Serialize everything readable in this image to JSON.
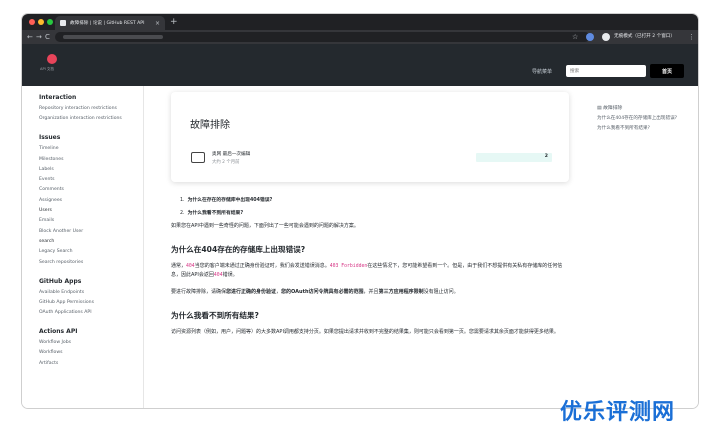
{
  "browser": {
    "tab_title": "故障排除 | 论说 | GitHub REST API",
    "tab_close": "×",
    "new_tab": "+",
    "back": "←",
    "forward": "→",
    "reload": "C",
    "star": "☆",
    "incognito_label": "无痕模式（已打开 2 个窗口）",
    "menu": "⋮"
  },
  "header": {
    "logo_sub": "API 文档",
    "nav_menu": "导航菜单",
    "search_placeholder": "搜索",
    "home_button": "首页"
  },
  "sidebar": {
    "groups": [
      {
        "title": "Interaction",
        "items": [
          "Repository interaction restrictions",
          "Organization interaction restrictions"
        ]
      },
      {
        "title": "Issues",
        "items": [
          "Timeline",
          "Milestones",
          "Labels",
          "Events",
          "Comments",
          "Assignees",
          "Users",
          "Emails",
          "Block Another User",
          "search",
          "Legacy Search",
          "Search repositories"
        ]
      },
      {
        "title": "GitHub Apps",
        "items": [
          "Available Endpoints",
          "GitHub App Permissions",
          "OAuth Applications API"
        ]
      },
      {
        "title": "Actions API",
        "items": [
          "Workflow Jobs",
          "Workflows",
          "Artifacts"
        ]
      }
    ]
  },
  "page": {
    "title": "故障排除",
    "edit_meta_1": "奥网 最后一次编辑",
    "edit_meta_2": "大约 2 个月前",
    "contributors": "2"
  },
  "article": {
    "toc": [
      {
        "num": "1.",
        "text": "为什么在存在的存储库中出现404错误?"
      },
      {
        "num": "2.",
        "text": "为什么我看不到所有结果?"
      }
    ],
    "intro": "如果您在API中遇到一些奇怪的问题，下面列出了一些可能会遇到的问题的解决方案。",
    "h2_1": "为什么在404存在的存储库上出现错误?",
    "p1_a": "通常，",
    "p1_code1": "404",
    "p1_b": "当您的客户端未通过正确身份验证时，我们会发送错误消息。",
    "p1_code2": "403 Forbidden",
    "p1_c": "在这些情况下，您可能希望看到一个。但是，由于我们不想提供有关私有存储库的任何信息，因此API会返回",
    "p1_code3": "404",
    "p1_d": "错误。",
    "p2_a": "要进行故障排除，请确保",
    "p2_b1": "您进行正确的身份验证",
    "p2_c": "，",
    "p2_b2": "您的OAuth访问令牌具有必需的范围",
    "p2_d": "，并且",
    "p2_b3": "第三方应用程序限制",
    "p2_e": "没有阻止访问。",
    "h2_2": "为什么我看不到所有结果?",
    "p3": "访问资源列表（例如，用户，问题等）的大多数API调用都支持分页。如果您提出请求并收到不完整的结果集，则可能只会看到第一页。您需要请求其余页面才能获得更多结果。"
  },
  "right_toc": {
    "title": "故障排除",
    "items": [
      "为什么在404存在的存储库上出现错误?",
      "为什么我看不到所有结果?"
    ]
  },
  "watermark": "优乐评测网"
}
